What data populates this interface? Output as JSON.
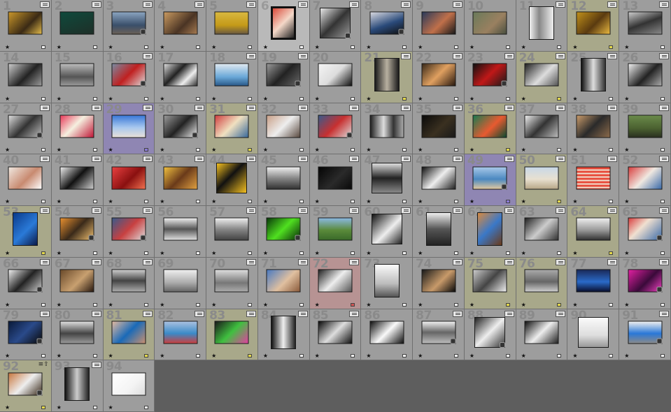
{
  "colors": {
    "background": "#5e5e5e",
    "cell": "#9d9d9d",
    "cell_selected": "#b9b9b9",
    "label_yellow": "#a8a88a",
    "label_purple": "#8f86b3",
    "label_red": "#b79393"
  },
  "icons": {
    "badge": "filmstrip-badge-icon",
    "stack": "stack-arrow-icon",
    "edit": "develop-edit-icon",
    "star": "star-icon"
  },
  "cells": [
    {
      "n": "1",
      "b": 1,
      "f": "linear-gradient(135deg,#c8962a,#3a2a15 60%,#e0b84a)",
      "r": 1
    },
    {
      "n": "2",
      "b": 1,
      "f": "linear-gradient(160deg,#0f4a3c,#1e2f28)"
    },
    {
      "n": "3",
      "b": 1,
      "f": "linear-gradient(180deg,#8aa4c0,#3a4f6a 60%,#6a6058)",
      "e": 1
    },
    {
      "n": "4",
      "b": 1,
      "f": "linear-gradient(135deg,#c99a60,#4a3424 60%,#a57a50)"
    },
    {
      "n": "5",
      "b": 1,
      "f": "linear-gradient(180deg,#d9b840,#c49a18 60%,#6a5a40)"
    },
    {
      "n": "6",
      "b": 1,
      "f": "linear-gradient(135deg,#d94a3a,#f4d8c8 50%,#222)",
      "o": "portrait",
      "boxed": 1,
      "s": 1
    },
    {
      "n": "7",
      "b": 1,
      "f": "linear-gradient(135deg,#e8e8e8,#333 50%,#999)",
      "o": "square",
      "e": 1
    },
    {
      "n": "8",
      "b": 1,
      "f": "linear-gradient(160deg,#d8d8e0,#2a4a7a 55%,#111)",
      "e": 1
    },
    {
      "n": "9",
      "b": 1,
      "f": "linear-gradient(135deg,#2a3a5a,#c0704a 55%,#1a1a1a)"
    },
    {
      "n": "10",
      "f": "linear-gradient(135deg,#6a7a5a,#9a8060 60%,#4a5040)"
    },
    {
      "n": "11",
      "b": 1,
      "f": "linear-gradient(90deg,#f0f0f0,#888 40%,#eee)",
      "o": "portrait"
    },
    {
      "n": "12",
      "b": 1,
      "l": "yellow",
      "f": "linear-gradient(135deg,#c0901a,#5a3a10 55%,#e8b840)",
      "y": 1
    },
    {
      "n": "13",
      "b": 1,
      "f": "linear-gradient(160deg,#ccc,#333 50%,#888)"
    },
    {
      "n": "14",
      "f": "linear-gradient(135deg,#ccc,#222 55%,#999)"
    },
    {
      "n": "15",
      "f": "linear-gradient(180deg,#bbb,#555 60%,#999)"
    },
    {
      "n": "16",
      "b": 1,
      "f": "linear-gradient(135deg,#7a8aa0,#c02020 50%,#ddd)",
      "e": 1
    },
    {
      "n": "17",
      "f": "linear-gradient(135deg,#ddd,#222 40%,#eee 70%,#333)"
    },
    {
      "n": "18",
      "b": 1,
      "f": "linear-gradient(180deg,#dfe8f0,#6aa8d8 60%,#2a5a8a)"
    },
    {
      "n": "19",
      "b": 1,
      "f": "linear-gradient(135deg,#999,#222 50%,#666)",
      "e": 1
    },
    {
      "n": "20",
      "f": "linear-gradient(135deg,#f4f4f4,#ddd 50%,#111)"
    },
    {
      "n": "21",
      "b": 1,
      "l": "yellow",
      "f": "linear-gradient(90deg,#1a1a1a,#b8b0a0 50%,#1a1a1a)",
      "o": "portrait",
      "y": 1
    },
    {
      "n": "22",
      "b": 1,
      "f": "linear-gradient(135deg,#3a2a1a,#e0a060 50%,#2a1a10)"
    },
    {
      "n": "23",
      "b": 1,
      "f": "linear-gradient(135deg,#111,#c01818 50%,#1a1a1a)",
      "e": 1
    },
    {
      "n": "24",
      "b": 1,
      "l": "yellow",
      "f": "linear-gradient(135deg,#222,#ddd 55%,#555)",
      "y": 1
    },
    {
      "n": "25",
      "b": 1,
      "f": "linear-gradient(90deg,#111,#ddd 50%,#333)",
      "o": "portrait"
    },
    {
      "n": "26",
      "b": 1,
      "f": "linear-gradient(135deg,#eee,#222 55%,#aaa)"
    },
    {
      "n": "27",
      "b": 1,
      "f": "linear-gradient(135deg,#ddd,#333 50%,#bbb)",
      "e": 1
    },
    {
      "n": "28",
      "b": 1,
      "f": "linear-gradient(135deg,#e83a5a,#f5f0e0 45%,#c01838)"
    },
    {
      "n": "29",
      "b": 1,
      "l": "purple",
      "f": "linear-gradient(180deg,#3a78d8,#a8c8ee 55%,#e8e0d8)",
      "pf": 1
    },
    {
      "n": "30",
      "b": 1,
      "f": "linear-gradient(135deg,#999,#222 50%,#eee)",
      "e": 1
    },
    {
      "n": "31",
      "b": 1,
      "l": "yellow",
      "f": "linear-gradient(135deg,#d04040,#f0e0c0 50%,#3a6a9a)",
      "y": 1
    },
    {
      "n": "32",
      "b": 1,
      "f": "linear-gradient(135deg,#c8a088,#eee 50%,#5a4a40)"
    },
    {
      "n": "33",
      "b": 1,
      "f": "linear-gradient(135deg,#3a5a8a,#c83030 50%,#ddd)",
      "e": 1
    },
    {
      "n": "34",
      "b": 1,
      "f": "linear-gradient(90deg,#222,#ddd 40%,#333 70%,#aaa)"
    },
    {
      "n": "35",
      "b": 1,
      "f": "linear-gradient(135deg,#0a0a0a,#3a3020 55%,#1a1a1a)"
    },
    {
      "n": "36",
      "b": 1,
      "l": "yellow",
      "f": "linear-gradient(135deg,#1a7a50,#e85a30 55%,#0e4a30)",
      "y": 1
    },
    {
      "n": "37",
      "b": 1,
      "f": "linear-gradient(135deg,#eee,#333 50%,#bbb)"
    },
    {
      "n": "38",
      "b": 1,
      "f": "linear-gradient(135deg,#c89a6a,#2a2a2a 50%,#8a6a4a)"
    },
    {
      "n": "39",
      "b": 1,
      "f": "linear-gradient(180deg,#6a8a4a,#4a6030 60%,#2a3020)"
    },
    {
      "n": "40",
      "b": 1,
      "f": "linear-gradient(135deg,#f0e8e0,#c88a70 55%,#fff)"
    },
    {
      "n": "41",
      "b": 1,
      "f": "linear-gradient(135deg,#eee,#111 50%,#ccc)"
    },
    {
      "n": "42",
      "b": 1,
      "f": "linear-gradient(135deg,#e84040,#8a1010 55%,#f07050)"
    },
    {
      "n": "43",
      "b": 1,
      "f": "linear-gradient(135deg,#f0c040,#6a3a1a 50%,#e0a040)"
    },
    {
      "n": "44",
      "b": 1,
      "f": "linear-gradient(135deg,#f4c020,#111 45%,#f4c020)",
      "o": "square"
    },
    {
      "n": "45",
      "b": 1,
      "f": "linear-gradient(180deg,#eee,#888 50%,#333)"
    },
    {
      "n": "46",
      "b": 1,
      "f": "linear-gradient(135deg,#050505,#2a2a2a 55%,#0a0a0a)"
    },
    {
      "n": "47",
      "b": 1,
      "f": "linear-gradient(180deg,#ddd,#222 50%,#888)",
      "o": "square"
    },
    {
      "n": "48",
      "b": 1,
      "f": "linear-gradient(135deg,#111,#eee 50%,#222)"
    },
    {
      "n": "49",
      "b": 1,
      "l": "purple",
      "f": "linear-gradient(180deg,#a8c8e8,#4a88c0 55%,#e0c8a0)",
      "e": 1,
      "pf": 1
    },
    {
      "n": "50",
      "b": 1,
      "l": "yellow",
      "f": "linear-gradient(180deg,#c8d8e8,#e8e0d0 55%,#b8a888)",
      "y": 1
    },
    {
      "n": "51",
      "b": 1,
      "f": "repeating-linear-gradient(180deg,#e84a3a 0 3px,#f0e0d0 3px 5px)"
    },
    {
      "n": "52",
      "b": 1,
      "f": "linear-gradient(135deg,#d84040,#f0e8e0 50%,#3a6aa8)"
    },
    {
      "n": "53",
      "b": 1,
      "l": "yellow",
      "f": "linear-gradient(135deg,#0a3a8a,#2a7ad8 55%,#0a1a4a)",
      "o": "portrait",
      "y": 1
    },
    {
      "n": "54",
      "b": 1,
      "f": "linear-gradient(135deg,#e89030,#3a2a1a 50%,#f0c070)",
      "e": 1
    },
    {
      "n": "55",
      "b": 1,
      "f": "linear-gradient(135deg,#3a5a8a,#c84040 50%,#ddd)",
      "e": 1
    },
    {
      "n": "56",
      "f": "linear-gradient(180deg,#eee,#555 50%,#ddd)"
    },
    {
      "n": "57",
      "b": 1,
      "f": "linear-gradient(180deg,#eee,#888 50%,#444)"
    },
    {
      "n": "58",
      "b": 1,
      "f": "linear-gradient(135deg,#0a3a0a,#50e020 50%,#0a2a0a)",
      "e": 1
    },
    {
      "n": "59",
      "b": 1,
      "f": "linear-gradient(180deg,#8ab8e0,#5a8a3a 55%,#3a6a2a)"
    },
    {
      "n": "60",
      "b": 1,
      "f": "linear-gradient(135deg,#111,#eee 55%,#222)",
      "o": "square"
    },
    {
      "n": "61",
      "b": 1,
      "f": "linear-gradient(180deg,#eee,#555 50%,#222)",
      "o": "portrait"
    },
    {
      "n": "62",
      "b": 1,
      "f": "linear-gradient(135deg,#d88a40,#3a78c8 50%,#6a3a1a)",
      "o": "portrait"
    },
    {
      "n": "63",
      "b": 1,
      "f": "linear-gradient(135deg,#222,#ccc 50%,#333)"
    },
    {
      "n": "64",
      "b": 1,
      "l": "yellow",
      "f": "linear-gradient(180deg,#eee,#999 55%,#333)",
      "y": 1
    },
    {
      "n": "65",
      "b": 1,
      "f": "linear-gradient(135deg,#d84040,#f0e0d0 40%,#3a6aa8)",
      "e": 1
    },
    {
      "n": "66",
      "b": 1,
      "f": "linear-gradient(135deg,#eee,#222 50%,#ccc)",
      "e": 1
    },
    {
      "n": "67",
      "b": 1,
      "f": "linear-gradient(135deg,#6a4a2a,#c8a070 55%,#2a1a10)"
    },
    {
      "n": "68",
      "b": 1,
      "f": "linear-gradient(180deg,#ccc,#444 50%,#aaa)"
    },
    {
      "n": "69",
      "f": "linear-gradient(180deg,#eee,#aaa 60%,#666)"
    },
    {
      "n": "70",
      "b": 1,
      "f": "linear-gradient(180deg,#ddd,#777 60%,#aaa)"
    },
    {
      "n": "71",
      "b": 1,
      "f": "linear-gradient(135deg,#4a7ac0,#e0c0a0 55%,#8a5a3a)"
    },
    {
      "n": "72",
      "b": 1,
      "l": "red",
      "f": "linear-gradient(135deg,#222,#eee 50%,#555)",
      "rf": 1
    },
    {
      "n": "73",
      "f": "linear-gradient(180deg,#fafafa,#bbb 60%,#555)",
      "o": "portrait"
    },
    {
      "n": "74",
      "b": 1,
      "f": "linear-gradient(135deg,#1a1a1a,#c89a6a 55%,#0a0a0a)"
    },
    {
      "n": "75",
      "b": 1,
      "l": "yellow",
      "f": "linear-gradient(135deg,#ccc,#444 50%,#eee)",
      "y": 1
    },
    {
      "n": "76",
      "b": 1,
      "l": "yellow",
      "f": "linear-gradient(180deg,#aaa,#666 55%,#ccc)",
      "y": 1
    },
    {
      "n": "77",
      "b": 1,
      "f": "linear-gradient(180deg,#1a2a5a,#2a6ac8 55%,#0a1030)"
    },
    {
      "n": "78",
      "b": 1,
      "f": "linear-gradient(135deg,#e020a0,#3a0a3a 55%,#f040c0)",
      "e": 1
    },
    {
      "n": "79",
      "b": 1,
      "f": "linear-gradient(135deg,#0a1a3a,#2a4a8a 50%,#0a0a0a)",
      "e": 1
    },
    {
      "n": "80",
      "b": 1,
      "f": "linear-gradient(180deg,#ddd,#444 55%,#999)"
    },
    {
      "n": "81",
      "b": 1,
      "l": "yellow",
      "f": "linear-gradient(135deg,#e0b8a0,#1a6ab8 50%,#c89070)",
      "y": 1
    },
    {
      "n": "82",
      "b": 1,
      "f": "linear-gradient(180deg,#a8c0e0,#3a8ac8 55%,#c84040)"
    },
    {
      "n": "83",
      "b": 1,
      "l": "yellow",
      "f": "linear-gradient(135deg,#1a1a1a,#40c040 50%,#e040a0)",
      "y": 1
    },
    {
      "n": "84",
      "b": 1,
      "f": "linear-gradient(90deg,#111,#eee 50%,#222)",
      "o": "portrait"
    },
    {
      "n": "85",
      "b": 1,
      "f": "linear-gradient(135deg,#0a0a0a,#ddd 50%,#111)"
    },
    {
      "n": "86",
      "f": "linear-gradient(135deg,#111,#fafafa 50%,#111)"
    },
    {
      "n": "87",
      "b": 1,
      "f": "linear-gradient(180deg,#eee,#666 50%,#bbb)",
      "e": 1
    },
    {
      "n": "88",
      "b": 1,
      "f": "linear-gradient(135deg,#222,#eee 50%,#333)",
      "o": "square",
      "e": 1
    },
    {
      "n": "89",
      "b": 1,
      "f": "linear-gradient(135deg,#111,#eee 50%,#222)"
    },
    {
      "n": "90",
      "f": "linear-gradient(180deg,#fafafa,#ddd 60%,#999)",
      "o": "square"
    },
    {
      "n": "91",
      "b": 1,
      "f": "linear-gradient(180deg,#eee,#2a78d8 55%,#8a8a8a)",
      "e": 1
    },
    {
      "n": "92",
      "st": 1,
      "l": "yellow",
      "f": "linear-gradient(135deg,#c87840,#eee 50%,#3a2a1a)",
      "e": 1,
      "y": 1
    },
    {
      "n": "93",
      "b": 1,
      "f": "linear-gradient(90deg,#111,#ccc 50%,#222)",
      "o": "portrait"
    },
    {
      "n": "94",
      "f": "linear-gradient(135deg,#fff,#f4f4f4 60%,#ddd)"
    }
  ]
}
